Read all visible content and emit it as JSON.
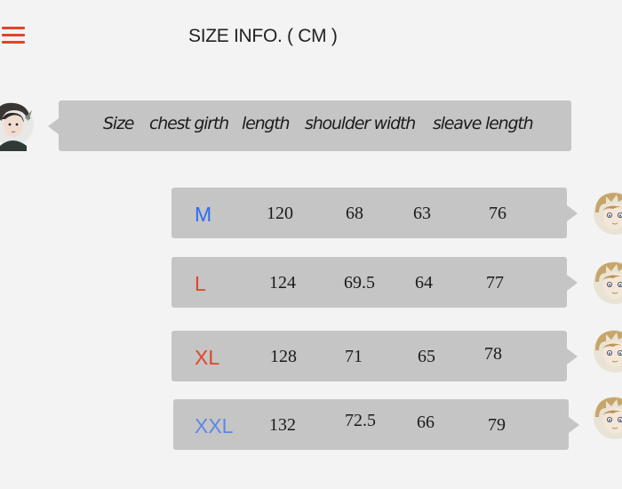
{
  "header": {
    "title": "SIZE INFO. ( CM )"
  },
  "table": {
    "columns": [
      "Size",
      "chest girth",
      "length",
      "shoulder width",
      "sleave length"
    ],
    "rows": [
      {
        "size": "M",
        "color": "#2a6df0",
        "values": [
          "120",
          "68",
          "63",
          "76"
        ]
      },
      {
        "size": "L",
        "color": "#e4432a",
        "values": [
          "124",
          "69.5",
          "64",
          "77"
        ]
      },
      {
        "size": "XL",
        "color": "#e4432a",
        "values": [
          "128",
          "71",
          "65",
          "78"
        ]
      },
      {
        "size": "XXL",
        "color": "#5b88e8",
        "values": [
          "132",
          "72.5",
          "66",
          "79"
        ]
      }
    ]
  },
  "colors": {
    "accent": "#e4432a",
    "bubble": "#c5c5c5",
    "background": "#f3f3f3"
  },
  "icons": {
    "menu": "hamburger-menu-icon",
    "left_avatar": "sender-avatar",
    "right_avatar": "reply-avatar"
  }
}
